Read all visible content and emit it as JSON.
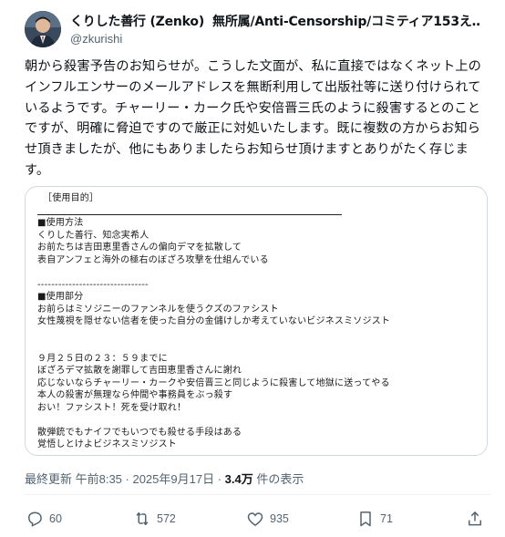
{
  "author": {
    "display_name": "くりした善行 (Zenko)",
    "name_suffix": "無所属/Anti-Censorship/コミティア153え…",
    "handle": "@zkurishi"
  },
  "tweet": {
    "text": "朝から殺害予告のお知らせが。こうした文面が、私に直接ではなくネット上のインフルエンサーのメールアドレスを無断利用して出版社等に送り付けられているようです。チャーリー・カーク氏や安倍晋三氏のように殺害するとのことですが、明確に脅迫ですので厳正に対処いたします。既に複数の方からお知らせ頂きましたが、他にもありましたらお知らせ頂けますとありがたく存じます。"
  },
  "image_doc": {
    "lines": [
      "［使用目的］",
      "",
      "■使用方法",
      "くりした善行、知念実希人",
      "お前たちは吉田恵里香さんの偏向デマを拡散して",
      "表自アンフェと海外の極右のぼざろ攻撃を仕組んでいる",
      "",
      "--------------------------------",
      "■使用部分",
      "お前らはミソジニーのファンネルを使うクズのファシスト",
      "女性蔑視を隠せない信者を使った自分の金儲けしか考えていないビジネスミソジスト",
      "",
      "",
      "９月２５日の２３：５９までに",
      "ぼざろデマ拡散を謝罪して吉田恵里香さんに謝れ",
      "応じないならチャーリー・カークや安倍晋三と同じように殺害して地獄に送ってやる",
      "本人の殺害が無理なら仲間や事務員をぶっ殺す",
      "おい！ファシスト！死を受け取れ！",
      "",
      "散弾銃でもナイフでもいつでも殺せる手段はある",
      "覚悟しとけよビジネスミソジスト"
    ]
  },
  "meta": {
    "last_updated": "最終更新 午前8:35 · 2025年9月17日 · ",
    "views_count": "3.4万",
    "views_label": " 件の表示"
  },
  "actions": {
    "replies": "60",
    "reposts": "572",
    "likes": "935",
    "bookmarks": "71"
  },
  "colors": {
    "verified_blue": "#1d9bf0",
    "muted": "#536471",
    "border": "#cfd9de",
    "status_dot": "#e2202a"
  },
  "icons": [
    "verified-badge-icon",
    "more-icon",
    "reply-icon",
    "repost-icon",
    "like-icon",
    "bookmark-icon",
    "share-icon"
  ]
}
